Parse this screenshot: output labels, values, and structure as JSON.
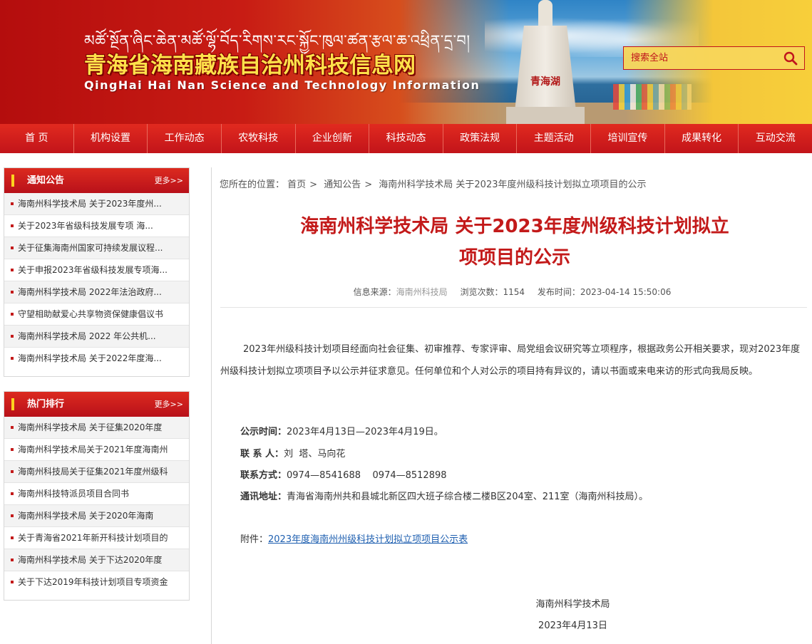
{
  "header": {
    "tibetan_title": "མཚོ་སྔོན་ཞིང་ཆེན་མཚོ་ལྷོ་བོད་རིགས་རང་སྐྱོང་ཁུལ་ཚན་རྩལ་ཆ་འཕྲིན་དྲ་བ།",
    "site_title": "青海省海南藏族自治州科技信息网",
    "site_subtitle": "QingHai Hai Nan Science and Technology Information",
    "monument_text": "青海湖",
    "search_placeholder": "搜索全站"
  },
  "nav": [
    "首 页",
    "机构设置",
    "工作动态",
    "农牧科技",
    "企业创新",
    "科技动态",
    "政策法规",
    "主题活动",
    "培训宣传",
    "成果转化",
    "互动交流"
  ],
  "sidebar": {
    "notice": {
      "title": "通知公告",
      "more": "更多>>",
      "items": [
        "海南州科学技术局 关于2023年度州...",
        "关于2023年省级科技发展专项 海...",
        "关于征集海南州国家可持续发展议程...",
        "关于申报2023年省级科技发展专项海...",
        "海南州科学技术局 2022年法治政府...",
        "守望相助献爱心共享物资保健康倡议书",
        "海南州科学技术局 2022 年公共机...",
        "海南州科学技术局 关于2022年度海..."
      ]
    },
    "hot": {
      "title": "热门排行",
      "more": "更多>>",
      "items": [
        "海南州科学技术局 关于征集2020年度",
        "海南州科学技术局关于2021年度海南州",
        "海南州科技局关于征集2021年度州级科",
        "海南州科技特派员项目合同书",
        "海南州科学技术局 关于2020年海南",
        "关于青海省2021年新开科技计划项目的",
        "海南州科学技术局 关于下达2020年度",
        "关于下达2019年科技计划项目专项资金"
      ]
    }
  },
  "article": {
    "breadcrumb_prefix": "您所在的位置：",
    "breadcrumb": [
      "首页",
      "通知公告",
      "海南州科学技术局 关于2023年度州级科技计划拟立项项目的公示"
    ],
    "title_line1": "海南州科学技术局 关于2023年度州级科技计划拟立",
    "title_line2": "项项目的公示",
    "meta": {
      "source_label": "信息来源：",
      "source": "海南州科技局",
      "views_label": "浏览次数：",
      "views": "1154",
      "time_label": "发布时间：",
      "time": "2023-04-14 15:50:06"
    },
    "body": "2023年州级科技计划项目经面向社会征集、初审推荐、专家评审、局党组会议研究等立项程序，根据政务公开相关要求，现对2023年度州级科技计划拟立项项目予以公示并征求意见。任何单位和个人对公示的项目持有异议的，请以书面或来电来访的形式向我局反映。",
    "info": [
      {
        "label": "公示时间：",
        "value": "2023年4月13日—2023年4月19日。"
      },
      {
        "label": "联 系 人：",
        "value": "刘  塔、马向花"
      },
      {
        "label": "联系方式：",
        "value": "0974—8541688    0974—8512898"
      },
      {
        "label": "通讯地址：",
        "value": "青海省海南州共和县城北新区四大班子综合楼二楼B区204室、211室（海南州科技局）。"
      }
    ],
    "attachment_label": "附件：",
    "attachment_link": "2023年度海南州州级科技计划拟立项项目公示表",
    "signature_org": "海南州科学技术局",
    "signature_date": "2023年4月13日"
  }
}
